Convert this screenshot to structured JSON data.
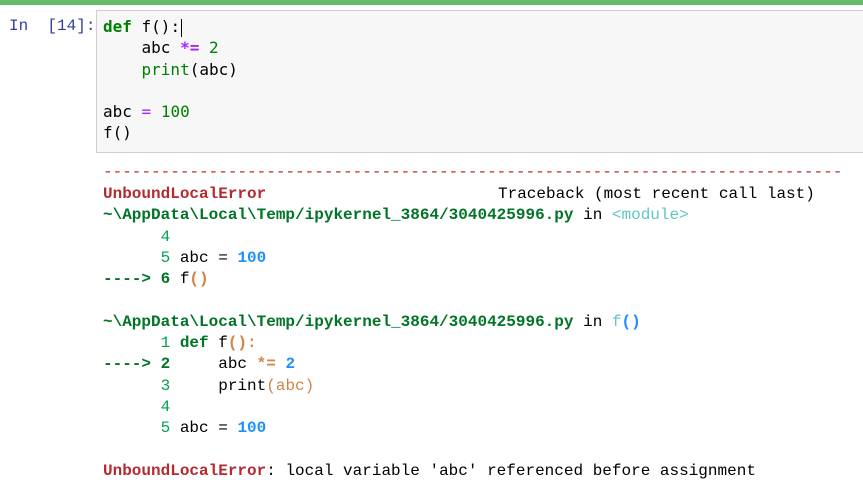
{
  "prompt": "In  [14]:",
  "cell": {
    "lines": {
      "l1_kw": "def",
      "l1_rest": " f():",
      "l2_a": "    abc ",
      "l2_op": "*=",
      "l2_sp": " ",
      "l2_num": "2",
      "l3_indent": "    ",
      "l3_bi": "print",
      "l3_rest": "(abc)",
      "l5_a": "abc ",
      "l5_op": "=",
      "l5_sp": " ",
      "l5_num": "100",
      "l6": "f()"
    }
  },
  "output": {
    "separator": "-----------------------------------------------------------------------------",
    "error_name": "UnboundLocalError",
    "traceback_label": "Traceback (most recent call last)",
    "frame1": {
      "path": "~\\AppData\\Local\\Temp/ipykernel_3864/3040425996.py",
      "in": " in ",
      "where": "<module>",
      "l4": "      4",
      "l5_no": "      5",
      "l5_code": " abc = ",
      "l5_num": "100",
      "arrow": "---->",
      "l6_no": " 6",
      "l6_code": " f",
      "l6_paren": "()"
    },
    "frame2": {
      "path": "~\\AppData\\Local\\Temp/ipykernel_3864/3040425996.py",
      "in": " in ",
      "where": "f",
      "where_paren": "()",
      "l1_no": "      1",
      "l1_kw": " def",
      "l1_rest": " f",
      "l1_paren": "():",
      "arrow": "---->",
      "l2_no": " 2",
      "l2_code": "     abc ",
      "l2_op": "*=",
      "l2_num": " 2",
      "l3_no": "      3",
      "l3_code": "     print",
      "l3_paren": "(abc)",
      "l4_no": "      4",
      "l5_no": "      5",
      "l5_code": " abc = ",
      "l5_num": "100"
    },
    "final_name": "UnboundLocalError",
    "final_msg": ": local variable 'abc' referenced before assignment"
  }
}
